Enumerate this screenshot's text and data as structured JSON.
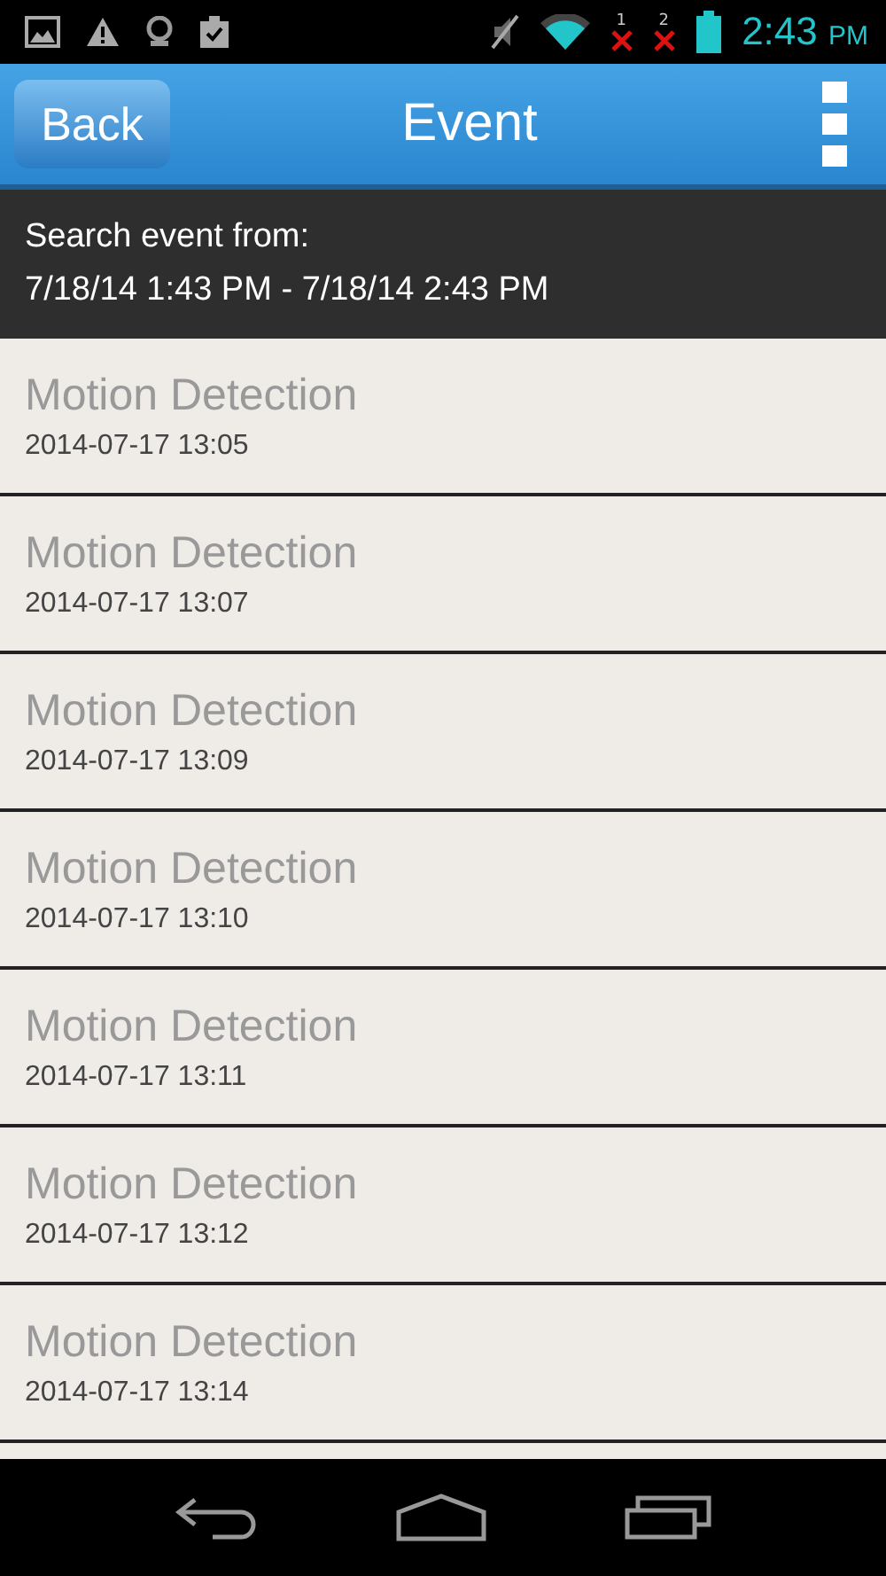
{
  "status_bar": {
    "sim_1": "1",
    "sim_2": "2",
    "time": "2:43",
    "ampm": "PM"
  },
  "header": {
    "back": "Back",
    "title": "Event"
  },
  "search": {
    "label": "Search event from:",
    "range": "7/18/14 1:43 PM - 7/18/14 2:43 PM"
  },
  "events": [
    {
      "title": "Motion Detection",
      "time": "2014-07-17 13:05"
    },
    {
      "title": "Motion Detection",
      "time": "2014-07-17 13:07"
    },
    {
      "title": "Motion Detection",
      "time": "2014-07-17 13:09"
    },
    {
      "title": "Motion Detection",
      "time": "2014-07-17 13:10"
    },
    {
      "title": "Motion Detection",
      "time": "2014-07-17 13:11"
    },
    {
      "title": "Motion Detection",
      "time": "2014-07-17 13:12"
    },
    {
      "title": "Motion Detection",
      "time": "2014-07-17 13:14"
    }
  ]
}
